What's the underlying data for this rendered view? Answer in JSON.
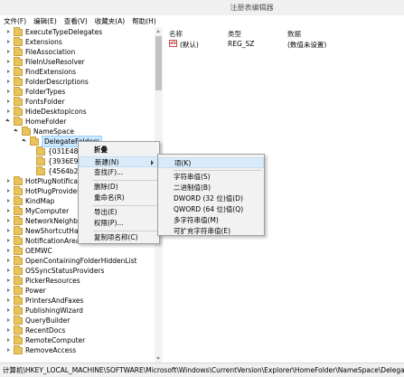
{
  "window": {
    "title": "注册表编辑器"
  },
  "menubar": [
    "文件(F)",
    "编辑(E)",
    "查看(V)",
    "收藏夹(A)",
    "帮助(H)"
  ],
  "tree": [
    "ExecuteTypeDelegates",
    "Extensions",
    "FileAssociation",
    "FileInUseResolver",
    "FindExtensions",
    "FolderDescriptions",
    "FolderTypes",
    "FontsFolder",
    "HideDesktopIcons",
    "HomeFolder",
    "NameSpace",
    "DelegateFolders",
    "{031E482",
    "{3936E9E",
    "{4564b2",
    "HotPlugNotificatio",
    "HotPlugProvider",
    "KindMap",
    "MyComputer",
    "NetworkNeighbor",
    "NewShortcutHandl",
    "NotificationArea",
    "OEMWC",
    "OpenContainingFolderHiddenList",
    "OSSyncStatusProviders",
    "PickerResources",
    "Power",
    "PrintersAndFaxes",
    "PublishingWizard",
    "QueryBuilder",
    "RecentDocs",
    "RemoteComputer",
    "RemoveAccess"
  ],
  "right_pane": {
    "headers": {
      "name": "名称",
      "type": "类型",
      "data": "数据"
    },
    "rows": [
      {
        "name": "(默认)",
        "type": "REG_SZ",
        "data": "(数值未设置)"
      }
    ]
  },
  "context_menu": [
    "折叠",
    "新建(N)",
    "查找(F)...",
    "删除(D)",
    "重命名(R)",
    "导出(E)",
    "权限(P)...",
    "复制项名称(C)"
  ],
  "submenu": [
    "项(K)",
    "字符串值(S)",
    "二进制值(B)",
    "DWORD (32 位)值(D)",
    "QWORD (64 位)值(Q)",
    "多字符串值(M)",
    "可扩充字符串值(E)"
  ],
  "statusbar": "计算机\\HKEY_LOCAL_MACHINE\\SOFTWARE\\Microsoft\\Windows\\CurrentVersion\\Explorer\\HomeFolder\\NameSpace\\DelegateFolders"
}
